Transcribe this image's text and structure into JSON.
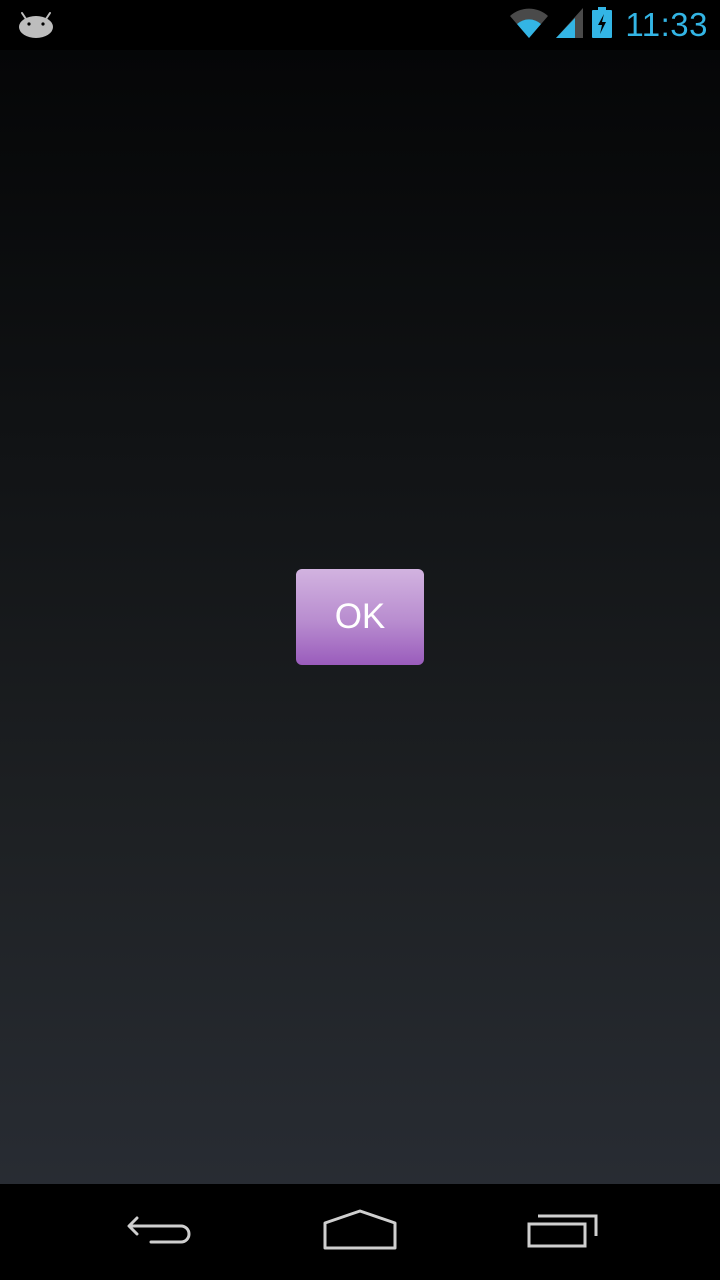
{
  "status_bar": {
    "notification_icon": "android-icon",
    "wifi_icon": "wifi-icon",
    "signal_icon": "cell-signal-icon",
    "battery_icon": "battery-charging-icon",
    "time": "11:33",
    "clock_color": "#33b5e5"
  },
  "main": {
    "ok_button_label": "OK",
    "ok_button_color": "#b88ccf"
  },
  "nav_bar": {
    "back_icon": "back-icon",
    "home_icon": "home-icon",
    "recents_icon": "recent-apps-icon"
  }
}
